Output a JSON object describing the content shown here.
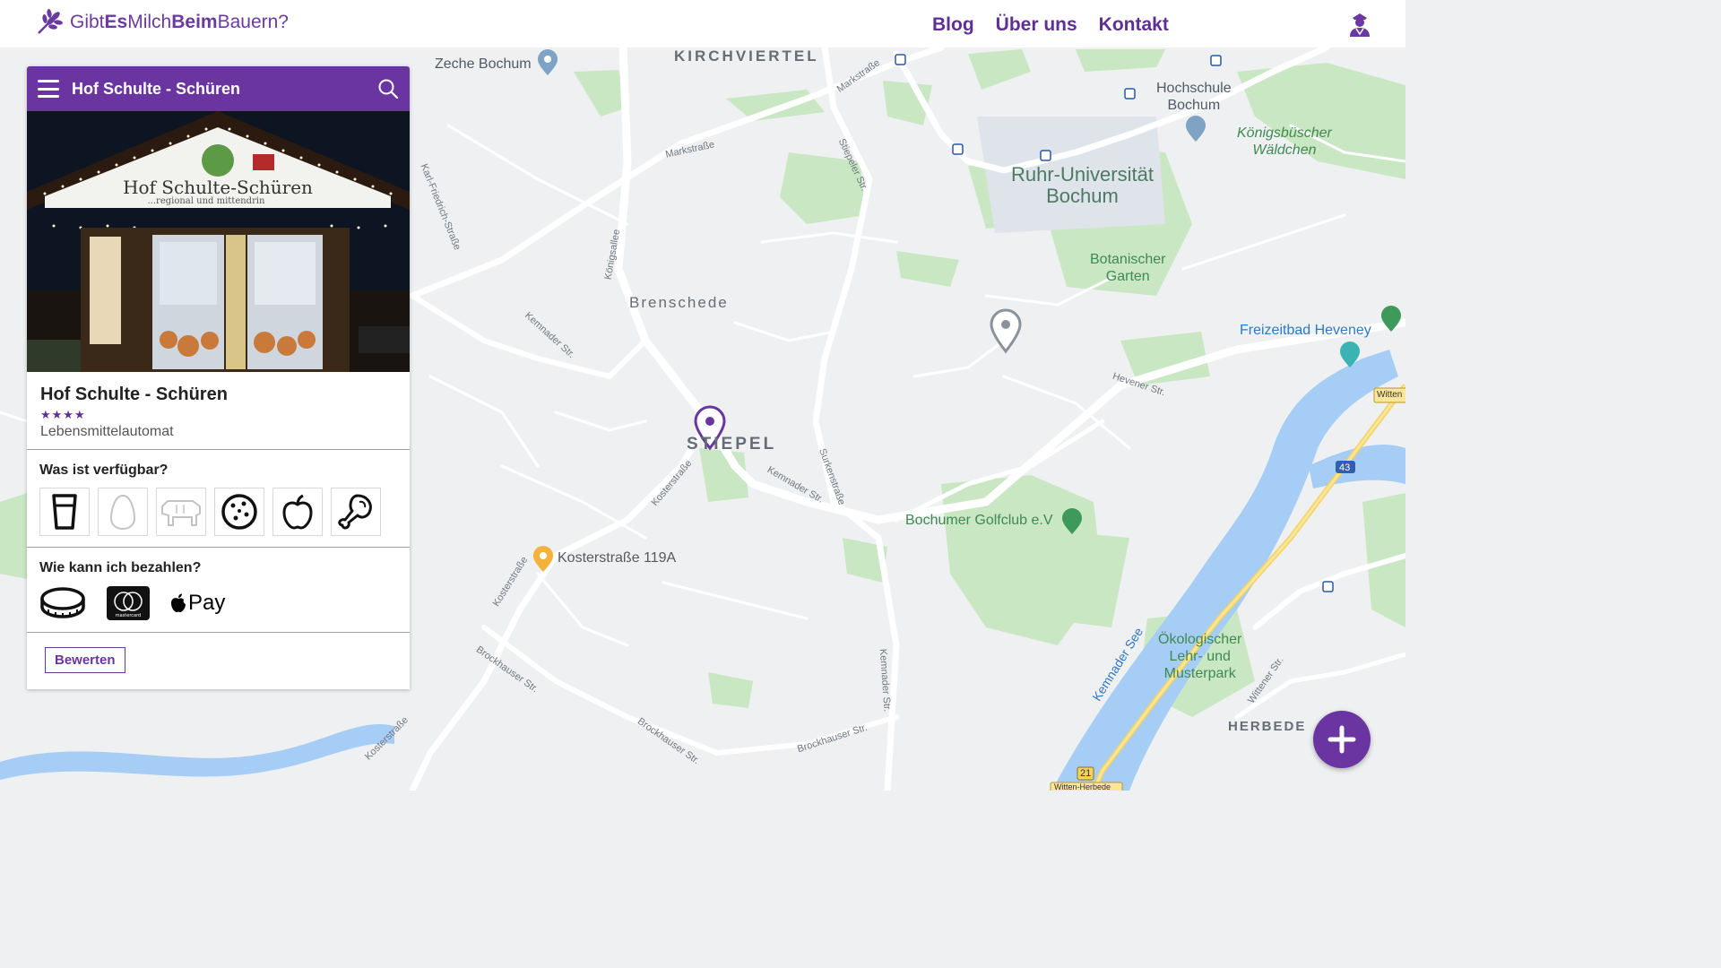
{
  "header": {
    "logo": {
      "part1": "Gibt",
      "part2": "Es",
      "part3": "Milch",
      "part4": "Beim",
      "part5": "Bauern",
      "part6": "?"
    },
    "nav": [
      "Blog",
      "Über uns",
      "Kontakt"
    ],
    "user_icon": "farmer-user-icon"
  },
  "panel": {
    "header_title": "Hof Schulte - Schüren",
    "photo_sign": "Hof Schulte-Schüren",
    "photo_subtitle": "...regional und mittendrin",
    "name": "Hof Schulte - Schüren",
    "rating": 4,
    "rating_text": "★★★★",
    "type": "Lebensmittelautomat",
    "products_heading": "Was ist verfügbar?",
    "products": [
      {
        "icon": "milk-glass-icon",
        "available": true
      },
      {
        "icon": "egg-icon",
        "available": false
      },
      {
        "icon": "cow-icon",
        "available": false
      },
      {
        "icon": "cookie-icon",
        "available": true
      },
      {
        "icon": "apple-icon",
        "available": true
      },
      {
        "icon": "meat-leg-icon",
        "available": true
      }
    ],
    "payment_heading": "Wie kann ich bezahlen?",
    "payments": [
      "coin-icon",
      "mastercard-icon",
      "apple-pay-icon"
    ],
    "apple_pay_label": "Pay",
    "mastercard_label": "mastercard",
    "rate_button": "Bewerten"
  },
  "map": {
    "labels": {
      "zeche": "Zeche Bochum",
      "kirchviertel": "KIRCHVIERTEL",
      "hochschule": "Hochschule\nBochum",
      "koenigsbuescher": "Königsbüscher\nWäldchen",
      "rub": "Ruhr-Universität\nBochum",
      "botanischer": "Botanischer\nGarten",
      "brenschede": "Brenschede",
      "freizeitbad": "Freizeitbad Heveney",
      "stiepel": "STIEPEL",
      "golfclub": "Bochumer Golfclub e.V",
      "kosterstrasse": "Kosterstraße 119A",
      "kemnader_see": "Kemnader See",
      "oekologischer": "Ökologischer\nLehr- und\nMusterpark",
      "herbede": "HERBEDE"
    },
    "streets": {
      "markstrasse": "Markstraße",
      "markstrasse2": "Markstraße",
      "karl_friedrich": "Karl-Friedrich-Straße",
      "koenigsallee": "Königsallee",
      "stiepeler": "Stiepeler Str.",
      "kemnader1": "Kemnader Str.",
      "kemnader2": "Kemnader Str.",
      "kemnader3": "Kemnader Str.",
      "surkenstrasse": "Surkenstraße",
      "kosterstrasse1": "Kosterstraße",
      "kosterstrasse2": "Kosterstraße",
      "kosterstrasse3": "Kosterstraße",
      "brockhauser1": "Brockhauser Str.",
      "brockhauser2": "Brockhauser Str.",
      "brockhauser3": "Brockhauser Str.",
      "hevener": "Hevener Str.",
      "wittener": "Wittener Str.",
      "witten_herbede": "Witten-Herbede",
      "a43": "43",
      "b21": "21",
      "witten": "Witten"
    }
  },
  "fab_label": "+",
  "colors": {
    "brand": "#6a35a0",
    "map_bg": "#eef0f1",
    "water": "#a5cdf5",
    "park": "#c8e6c2"
  }
}
